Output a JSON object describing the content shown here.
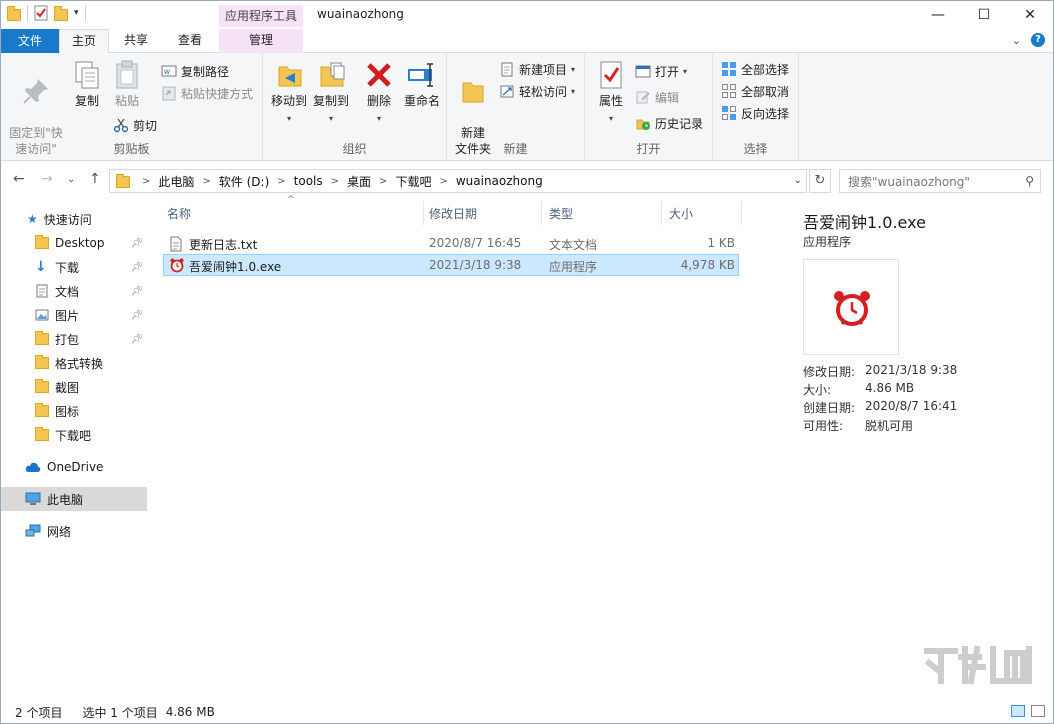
{
  "window": {
    "context_tab": "应用程序工具",
    "title": "wuainaozhong"
  },
  "tabs": {
    "file": "文件",
    "home": "主页",
    "share": "共享",
    "view": "查看",
    "manage": "管理"
  },
  "ribbon": {
    "clipboard": {
      "label": "剪贴板",
      "pin": "固定到\"快\n速访问\"",
      "copy": "复制",
      "paste": "粘贴",
      "copy_path": "复制路径",
      "paste_shortcut": "粘贴快捷方式",
      "cut": "剪切"
    },
    "organize": {
      "label": "组织",
      "move_to": "移动到",
      "copy_to": "复制到",
      "delete": "删除",
      "rename": "重命名"
    },
    "new": {
      "label": "新建",
      "new_folder": "新建\n文件夹",
      "new_item": "新建项目",
      "easy_access": "轻松访问"
    },
    "open": {
      "label": "打开",
      "properties": "属性",
      "open": "打开",
      "edit": "编辑",
      "history": "历史记录"
    },
    "select": {
      "label": "选择",
      "select_all": "全部选择",
      "select_none": "全部取消",
      "invert": "反向选择"
    }
  },
  "address": {
    "crumbs": [
      "此电脑",
      "软件 (D:)",
      "tools",
      "桌面",
      "下载吧",
      "wuainaozhong"
    ],
    "search_placeholder": "搜索\"wuainaozhong\""
  },
  "nav": {
    "quick_access": "快速访问",
    "items": [
      {
        "label": "Desktop",
        "pinned": true
      },
      {
        "label": "下载",
        "pinned": true
      },
      {
        "label": "文档",
        "pinned": true
      },
      {
        "label": "图片",
        "pinned": true
      },
      {
        "label": "打包",
        "pinned": true
      },
      {
        "label": "格式转换",
        "pinned": false
      },
      {
        "label": "截图",
        "pinned": false
      },
      {
        "label": "图标",
        "pinned": false
      },
      {
        "label": "下载吧",
        "pinned": false
      }
    ],
    "onedrive": "OneDrive",
    "this_pc": "此电脑",
    "network": "网络"
  },
  "columns": {
    "name": "名称",
    "modified": "修改日期",
    "type": "类型",
    "size": "大小"
  },
  "files": [
    {
      "name": "更新日志.txt",
      "modified": "2020/8/7 16:45",
      "type": "文本文档",
      "size": "1 KB",
      "selected": false
    },
    {
      "name": "吾爱闹钟1.0.exe",
      "modified": "2021/3/18 9:38",
      "type": "应用程序",
      "size": "4,978 KB",
      "selected": true
    }
  ],
  "details": {
    "title": "吾爱闹钟1.0.exe",
    "subtitle": "应用程序",
    "props": [
      {
        "key": "修改日期:",
        "value": "2021/3/18 9:38"
      },
      {
        "key": "大小:",
        "value": "4.86 MB"
      },
      {
        "key": "创建日期:",
        "value": "2020/8/7 16:41"
      },
      {
        "key": "可用性:",
        "value": "脱机可用"
      }
    ]
  },
  "status": {
    "count": "2 个项目",
    "selection": "选中 1 个项目",
    "size": "4.86 MB"
  },
  "colors": {
    "accent": "#1979ca",
    "selection": "#cce8ff",
    "context_tab": "#f6e3f7"
  }
}
